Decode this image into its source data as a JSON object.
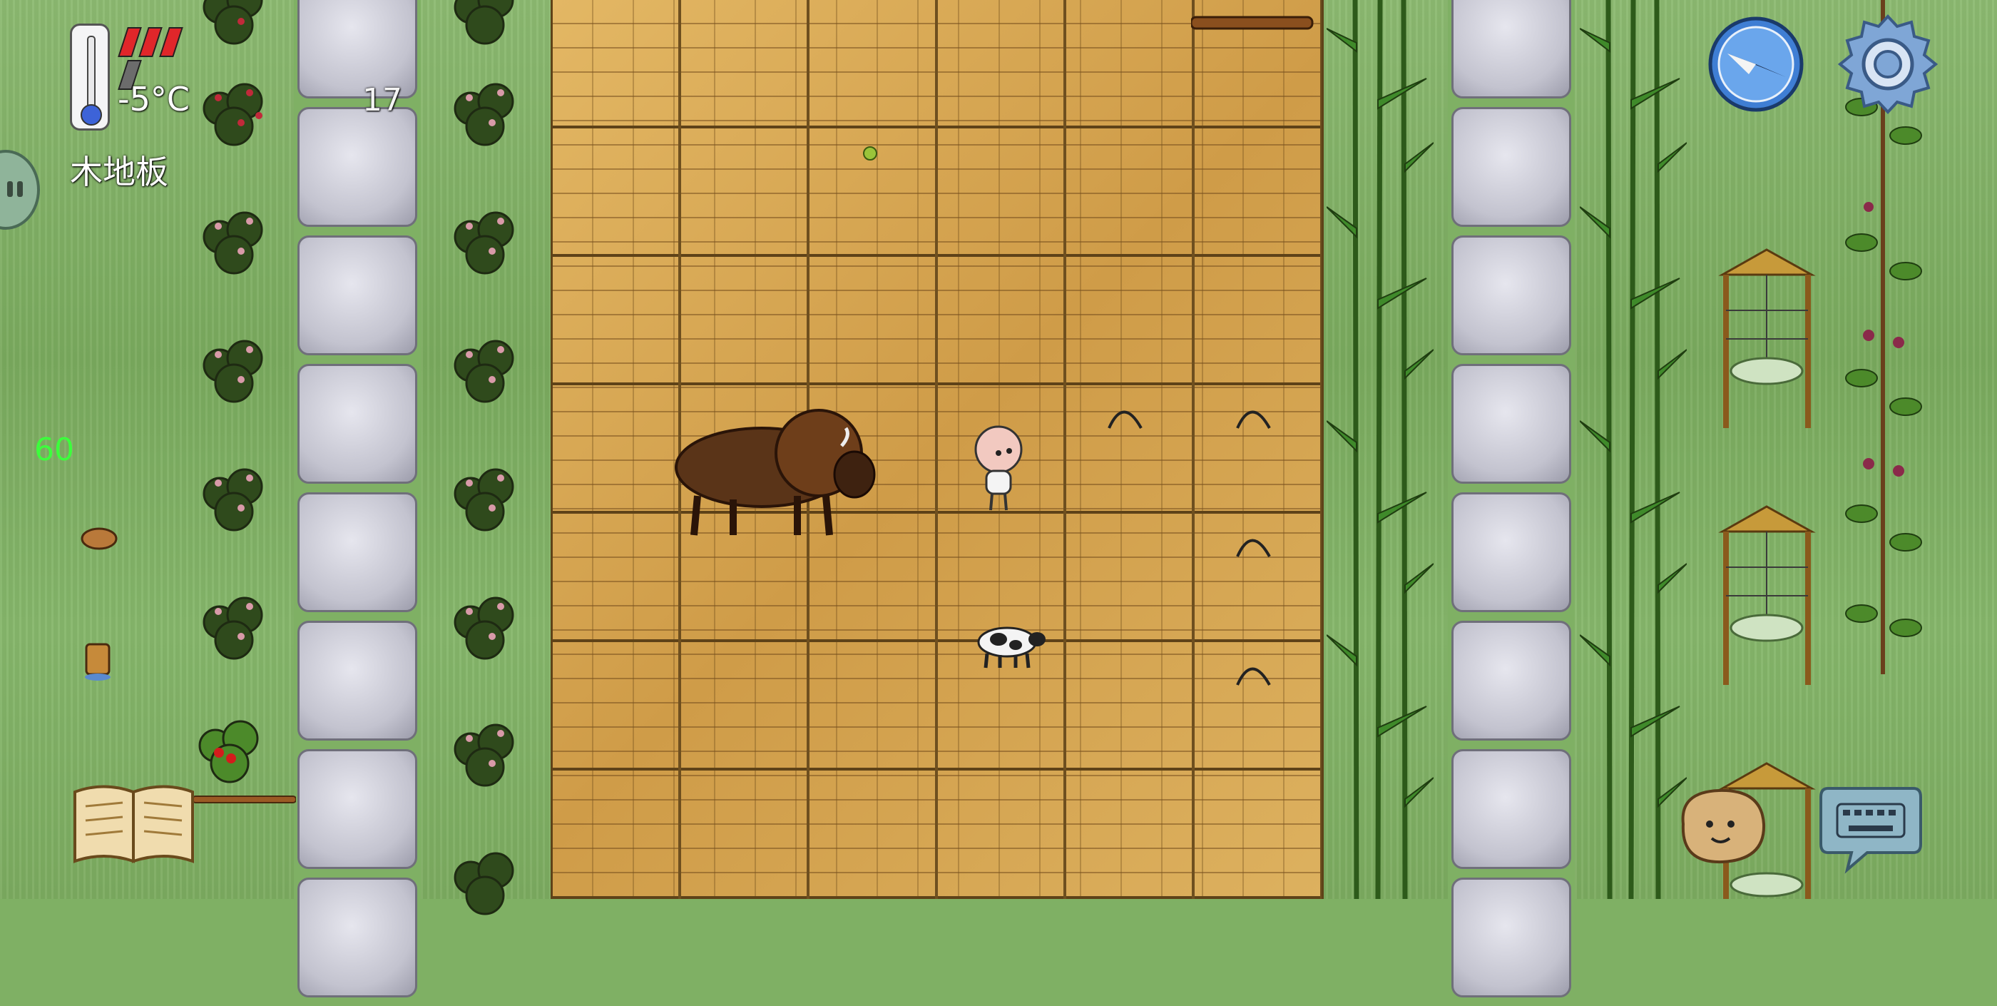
{
  "hud": {
    "temperature": "-5°C",
    "tile_name": "木地板",
    "age": "17",
    "fps": "60",
    "health_bars": {
      "filled": 3,
      "total": 4
    },
    "colors": {
      "health_filled": "#e0262a",
      "health_empty": "#6c6c6c",
      "fps_color": "#3cff3c",
      "thermo_bulb": "#3d63d8"
    }
  },
  "controls": {
    "compass": "compass-icon",
    "settings": "gear-icon",
    "recipe_book": "book-icon",
    "emote": "potato-face-icon",
    "keyboard": "keyboard-icon",
    "side_tab": "side-tab-icon"
  },
  "world": {
    "floor": "wooden-floor",
    "entities": [
      "bison",
      "baby-player",
      "cow",
      "basket",
      "bucket",
      "berry-bushes",
      "bamboo",
      "rose-bushes",
      "grape-vines",
      "drying-racks"
    ]
  }
}
